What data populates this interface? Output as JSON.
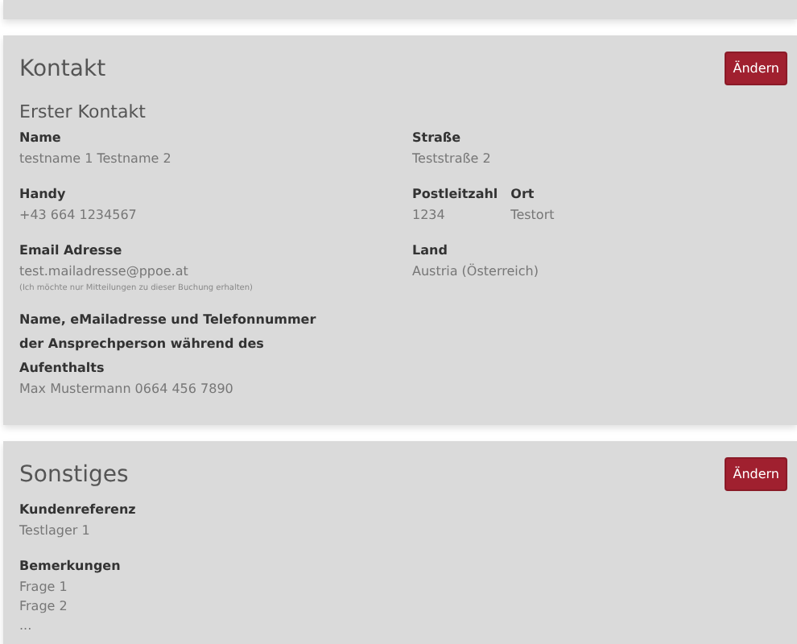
{
  "kontakt": {
    "title": "Kontakt",
    "button": "Ändern",
    "subtitle": "Erster Kontakt",
    "left": [
      {
        "label": "Name",
        "value": "testname 1 Testname 2"
      },
      {
        "label": "Handy",
        "value": "+43 664 1234567"
      },
      {
        "label": "Email Adresse",
        "value": "test.mailadresse@ppoe.at",
        "note": "(Ich möchte nur Mitteilungen zu dieser Buchung erhalten)"
      },
      {
        "label": "Name, eMailadresse und Telefonnummer der Ansprechperson während des Aufenthalts",
        "value": "Max Mustermann 0664 456 7890"
      }
    ],
    "right": [
      {
        "label": "Straße",
        "value": "Teststraße 2"
      },
      {
        "label": "Postleitzahl",
        "value": "1234",
        "side": {
          "label": "Ort",
          "value": "Testort"
        }
      },
      {
        "label": "Land",
        "value": "Austria (Österreich)"
      }
    ]
  },
  "sonstiges": {
    "title": "Sonstiges",
    "button": "Ändern",
    "fields": [
      {
        "label": "Kundenreferenz",
        "lines": [
          "Testlager 1"
        ]
      },
      {
        "label": "Bemerkungen",
        "lines": [
          "Frage 1",
          "Frage 2",
          "..."
        ]
      }
    ]
  }
}
